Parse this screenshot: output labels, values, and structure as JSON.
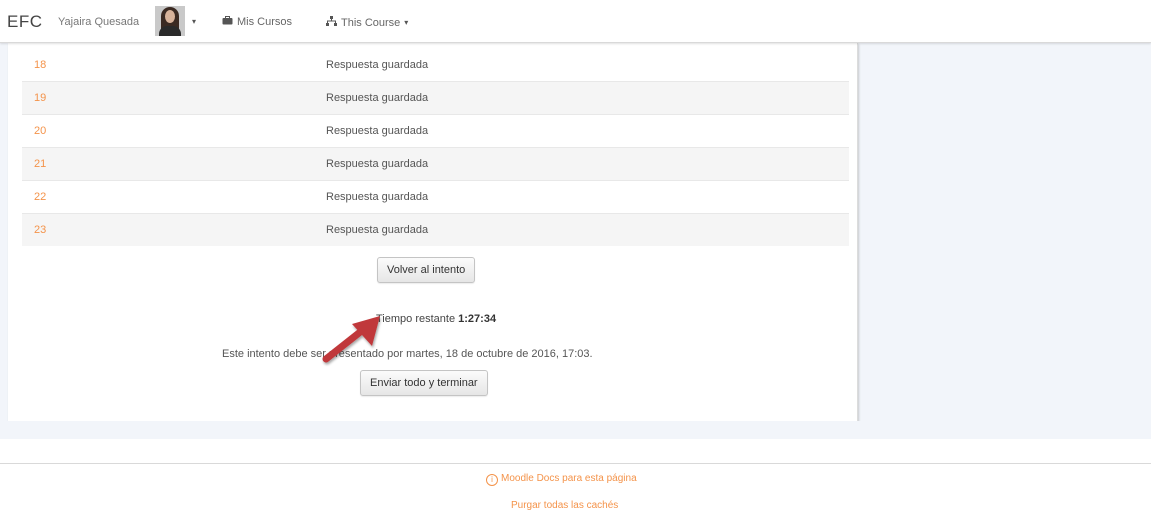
{
  "navbar": {
    "brand": "EFC",
    "user_name": "Yajaira Quesada",
    "my_courses_label": "Mis Cursos",
    "this_course_label": "This Course",
    "caret": "▾"
  },
  "summary": {
    "rows": [
      {
        "number": "18",
        "status": "Respuesta guardada"
      },
      {
        "number": "19",
        "status": "Respuesta guardada"
      },
      {
        "number": "20",
        "status": "Respuesta guardada"
      },
      {
        "number": "21",
        "status": "Respuesta guardada"
      },
      {
        "number": "22",
        "status": "Respuesta guardada"
      },
      {
        "number": "23",
        "status": "Respuesta guardada"
      }
    ]
  },
  "actions": {
    "return_button": "Volver al intento",
    "time_label": "Tiempo restante",
    "time_value": "1:27:34",
    "deadline_text": "Este intento debe ser presentado por martes, 18 de octubre de 2016, 17:03.",
    "submit_button": "Enviar todo y terminar"
  },
  "footer": {
    "info_icon": "i",
    "docs_link": "Moodle Docs para esta página",
    "purge_link": "Purgar todas las cachés"
  },
  "colors": {
    "accent_link": "#f4934a",
    "annotation_arrow": "#c0393b",
    "page_background": "#f2f5fa"
  },
  "icons": {
    "courses": "briefcase-icon",
    "this_course": "sitemap-icon",
    "docs": "info-circle-icon"
  }
}
